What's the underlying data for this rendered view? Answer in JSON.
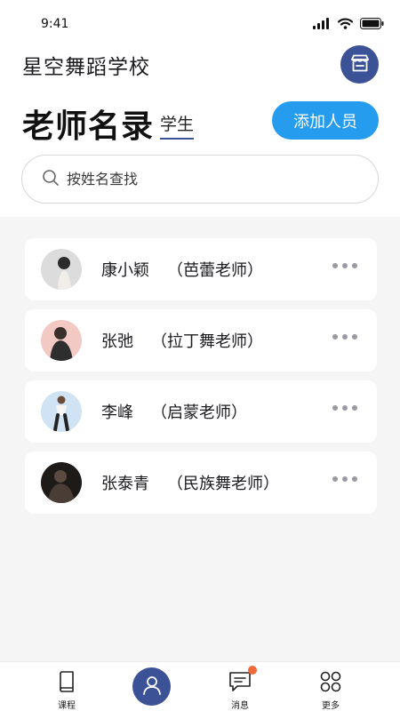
{
  "status_bar": {
    "time": "9:41"
  },
  "header": {
    "school_name": "星空舞蹈学校",
    "store_icon": "store-icon"
  },
  "title_row": {
    "title": "老师名录",
    "students_tab": "学生",
    "add_button": "添加人员"
  },
  "search": {
    "placeholder": "按姓名查找",
    "value": ""
  },
  "teachers": [
    {
      "name": "康小颖",
      "role": "（芭蕾老师）"
    },
    {
      "name": "张弛",
      "role": "（拉丁舞老师）"
    },
    {
      "name": "李峰",
      "role": "（启蒙老师）"
    },
    {
      "name": "张泰青",
      "role": "（民族舞老师）"
    }
  ],
  "bottom_nav": {
    "courses": "课程",
    "messages": "消息",
    "more": "更多"
  },
  "colors": {
    "primary_navy": "#3c5296",
    "accent_blue": "#259cee",
    "notification_dot": "#f06a3c"
  }
}
